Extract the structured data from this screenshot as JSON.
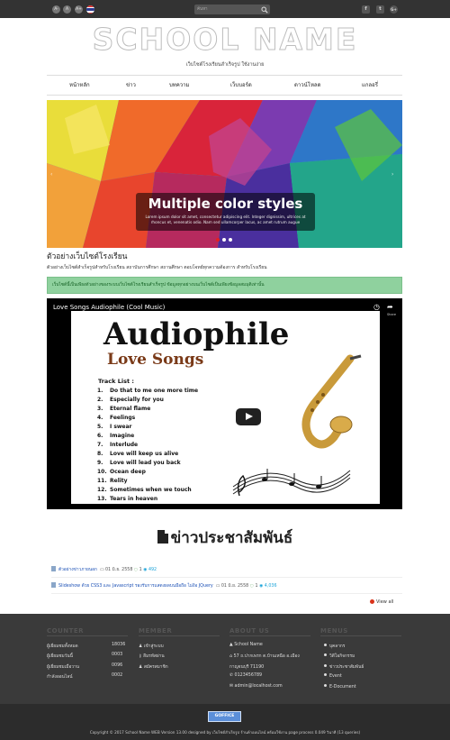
{
  "topbar": {
    "font_buttons": [
      "A-",
      "A",
      "A+"
    ],
    "search_placeholder": "ค้นหา",
    "social": [
      "f",
      "t",
      "G+"
    ]
  },
  "header": {
    "school_name": "SCHOOL NAME",
    "tagline": "เว็บไซต์โรงเรียนสำเร็จรูป ใช้งานง่าย"
  },
  "nav": {
    "items": [
      "หน้าหลัก",
      "ข่าว",
      "บทความ",
      "เว็บบอร์ด",
      "ดาวน์โหลด",
      "แกลอรี่"
    ]
  },
  "slider": {
    "title": "Multiple color styles",
    "text": "Lorem ipsum dolor sit amet, consectetur adipiscing elit. Integer dignissim, ultrices at rhoncus et, venenatis odio. Nam sed ullamcorper lacus, ac amet rutrum augue",
    "active_slide": 1,
    "slide_count": 3
  },
  "example": {
    "title": "ตัวอย่างเว็บไซต์โรงเรียน",
    "description": "ตัวอย่างเว็บไซต์สำเร็จรูปสำหรับโรงเรียน สถาบันการศึกษา สถานศึกษา ตอบโจทย์ทุกความต้องการ สำหรับโรงเรียน",
    "alert": "เว็บไซต์นี้เป็นเพียงตัวอย่างของระบบเว็บไซต์โรงเรียนสำเร็จรูป ข้อมูลทุกอย่างบนเว็บไซต์เป็นเพียงข้อมูลสมมุติเท่านั้น"
  },
  "video": {
    "title": "Love Songs Audiophile (Cool Music)",
    "icon_labels": [
      "",
      "Share"
    ],
    "thumb_title": "Audiophile",
    "thumb_subtitle": "Love Songs",
    "tracklist_label": "Track List :",
    "tracks": [
      {
        "n": "1.",
        "t": "Do that to me one more time"
      },
      {
        "n": "2.",
        "t": "Especially for you"
      },
      {
        "n": "3.",
        "t": "Eternal flame"
      },
      {
        "n": "4.",
        "t": "Feelings"
      },
      {
        "n": "5.",
        "t": "I swear"
      },
      {
        "n": "6.",
        "t": "Imagine"
      },
      {
        "n": "7.",
        "t": "Interlude"
      },
      {
        "n": "8.",
        "t": "Love will keep us alive"
      },
      {
        "n": "9.",
        "t": "Love will lead you back"
      },
      {
        "n": "10.",
        "t": "Ocean deep"
      },
      {
        "n": "11.",
        "t": "Relity"
      },
      {
        "n": "12.",
        "t": "Sometimes when we touch"
      },
      {
        "n": "13.",
        "t": "Tears in heaven"
      }
    ]
  },
  "news": {
    "heading": "ข่าวประชาสัมพันธ์",
    "items": [
      {
        "title": "ตัวอย่างข่าวภายนอก",
        "date": "01 มิ.ย. 2558",
        "comments": "1",
        "views": "492"
      },
      {
        "title": "Slideshow ด้วย CSS3 และ Javascript รองรับการแสดงผลบนมือถือ ไม่ง้อ JQuery",
        "date": "01 มิ.ย. 2558",
        "comments": "1",
        "views": "4,036"
      }
    ],
    "view_all": "View all"
  },
  "footer": {
    "counter": {
      "heading": "COUNTER",
      "rows": [
        {
          "label": "ผู้เยี่ยมชมทั้งหมด",
          "value": "18036"
        },
        {
          "label": "ผู้เยี่ยมชมวันนี้",
          "value": "0003"
        },
        {
          "label": "ผู้เยี่ยมชมเมื่อวาน",
          "value": "0096"
        },
        {
          "label": "กำลังออนไลน์",
          "value": "0002"
        }
      ]
    },
    "member": {
      "heading": "MEMBER",
      "rows": [
        "เข้าสู่ระบบ",
        "ลืมรหัสผ่าน",
        "สมัครสมาชิก"
      ]
    },
    "about": {
      "heading": "ABOUT US",
      "rows": [
        "School Name",
        "57 ถ.ปากเพรก ต.บ้านเหนือ อ.เมือง",
        "กาญจนบุรี 71190",
        "0123456789",
        "admin@localhost.com"
      ]
    },
    "menus": {
      "heading": "MENUS",
      "rows": [
        "บุคลากร",
        "วิดีโอกิจกรรม",
        "ข่าวประชาสัมพันธ์",
        "Event",
        "E-Document"
      ]
    },
    "badge": "GOFFICE",
    "copyright": "Copyright © 2017 School Name WEB Version 13.00 designed by เว็บไซต์สำเร็จรูป ร้านค้าออนไลน์ พร้อมใช้งาน page process 0.049 วินาที (13 queries)"
  }
}
